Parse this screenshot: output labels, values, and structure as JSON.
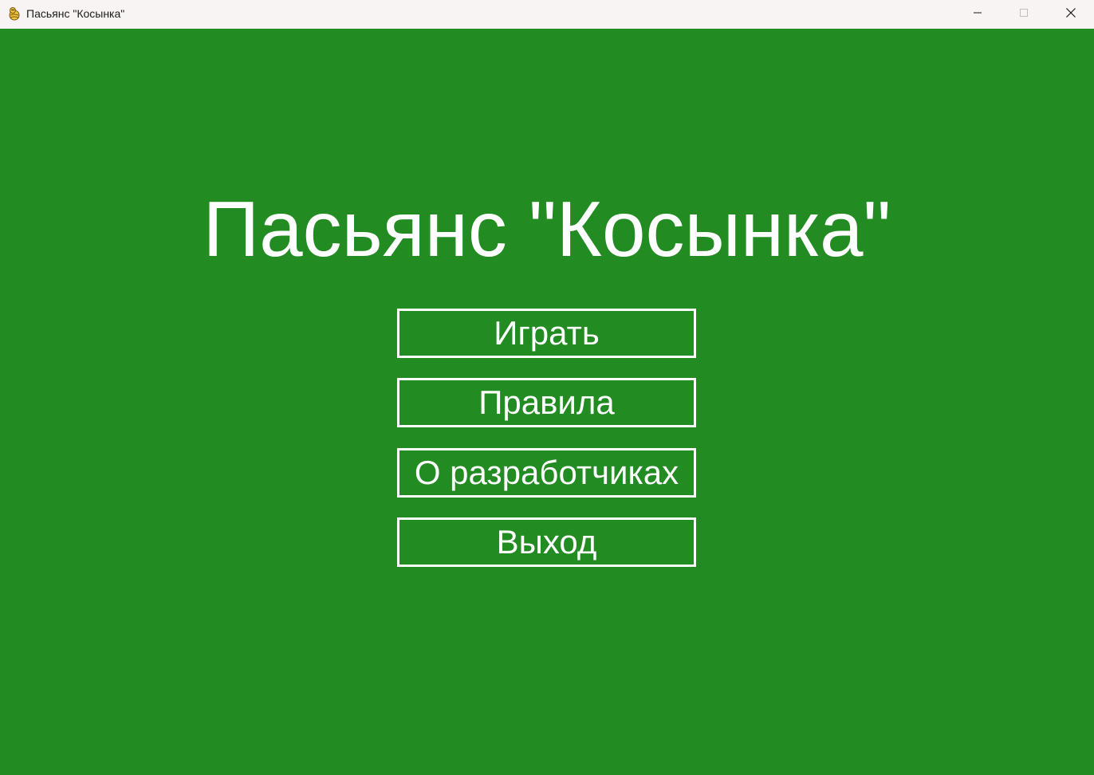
{
  "window": {
    "title": "Пасьянс \"Косынка\"",
    "background_color": "#228B22",
    "app_icon": "pygame-snake-icon",
    "controls": {
      "minimize_icon": "minimize-icon",
      "maximize_icon": "maximize-icon",
      "close_icon": "close-icon"
    }
  },
  "menu": {
    "title": "Пасьянс \"Косынка\"",
    "buttons": [
      {
        "label": "Играть"
      },
      {
        "label": "Правила"
      },
      {
        "label": "О разработчиках"
      },
      {
        "label": "Выход"
      }
    ]
  }
}
